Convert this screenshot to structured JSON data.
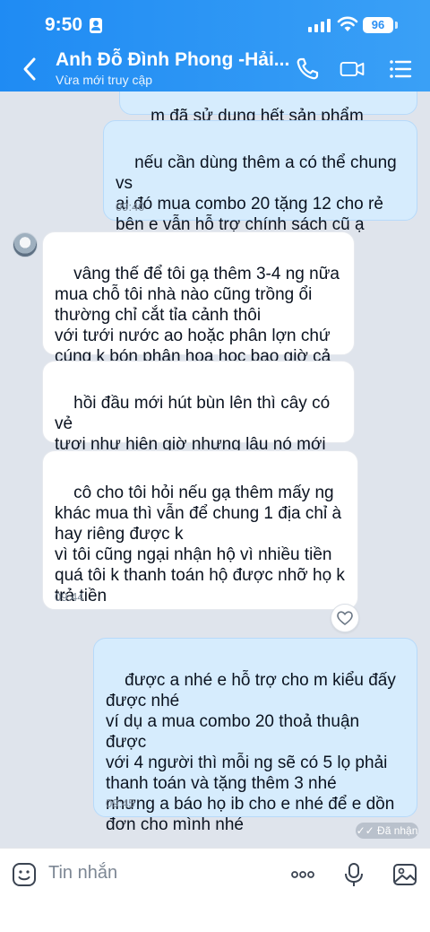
{
  "status_bar": {
    "time": "9:50",
    "battery": "96"
  },
  "header": {
    "title": "Anh Đỗ Đình Phong -Hải...",
    "subtitle": "Vừa mới truy cập",
    "icons": [
      "back-icon",
      "phone-icon",
      "video-icon",
      "menu-icon"
    ]
  },
  "messages": [
    {
      "side": "out",
      "text": "m đã sử dụng hết sản phẩm chưa ạ?"
    },
    {
      "side": "out",
      "text": "nếu cần dùng thêm a có thể chung vs\nai đó mua combo 20 tặng 12 cho rẻ\nbên e vẫn hỗ trợ chính sách cũ ạ",
      "time": "09:40"
    },
    {
      "side": "in",
      "text": "vâng thế để tôi gạ thêm 3-4 ng nữa\nmua chỗ tôi nhà nào cũng trồng ổi\nthường chỉ cắt tỉa cảnh thôi\nvới tưới nước ao hoặc phân lợn chứ\ncúng k bón phân hoa học bao giờ cả"
    },
    {
      "side": "in",
      "text": "hồi đầu mới hút bùn lên thì cây có vẻ\ntươi như hiện giờ nhưng lâu nó mới xơ\nxác thế"
    },
    {
      "side": "in",
      "text": "cô cho tôi hỏi nếu gạ thêm mấy ng\nkhác mua thì vẫn để chung 1 địa chỉ à\nhay riêng được k\nvì tôi cũng ngại nhận hộ vì nhiều tiền\nquá tôi k thanh toán hộ được nhỡ họ k\ntrả tiền",
      "time": "09:44"
    },
    {
      "side": "out",
      "text": "được a nhé e hỗ trợ cho m kiểu đấy\nđược nhé\nví dụ a mua combo 20 thoả thuận được\nvới 4 người thì mỗi ng sẽ có 5 lọ phải\nthanh toán và tặng thêm 3 nhé\nnhưng a báo họ ib cho e nhé để e dồn\nđơn cho mình nhé",
      "time": "09:45"
    }
  ],
  "received_label": "Đã nhận",
  "input": {
    "placeholder": "Tin nhắn"
  },
  "colors": {
    "header": "#2a93f4",
    "outgoing": "#d6ecfd",
    "incoming": "#ffffff",
    "background": "#dfe4ec"
  }
}
